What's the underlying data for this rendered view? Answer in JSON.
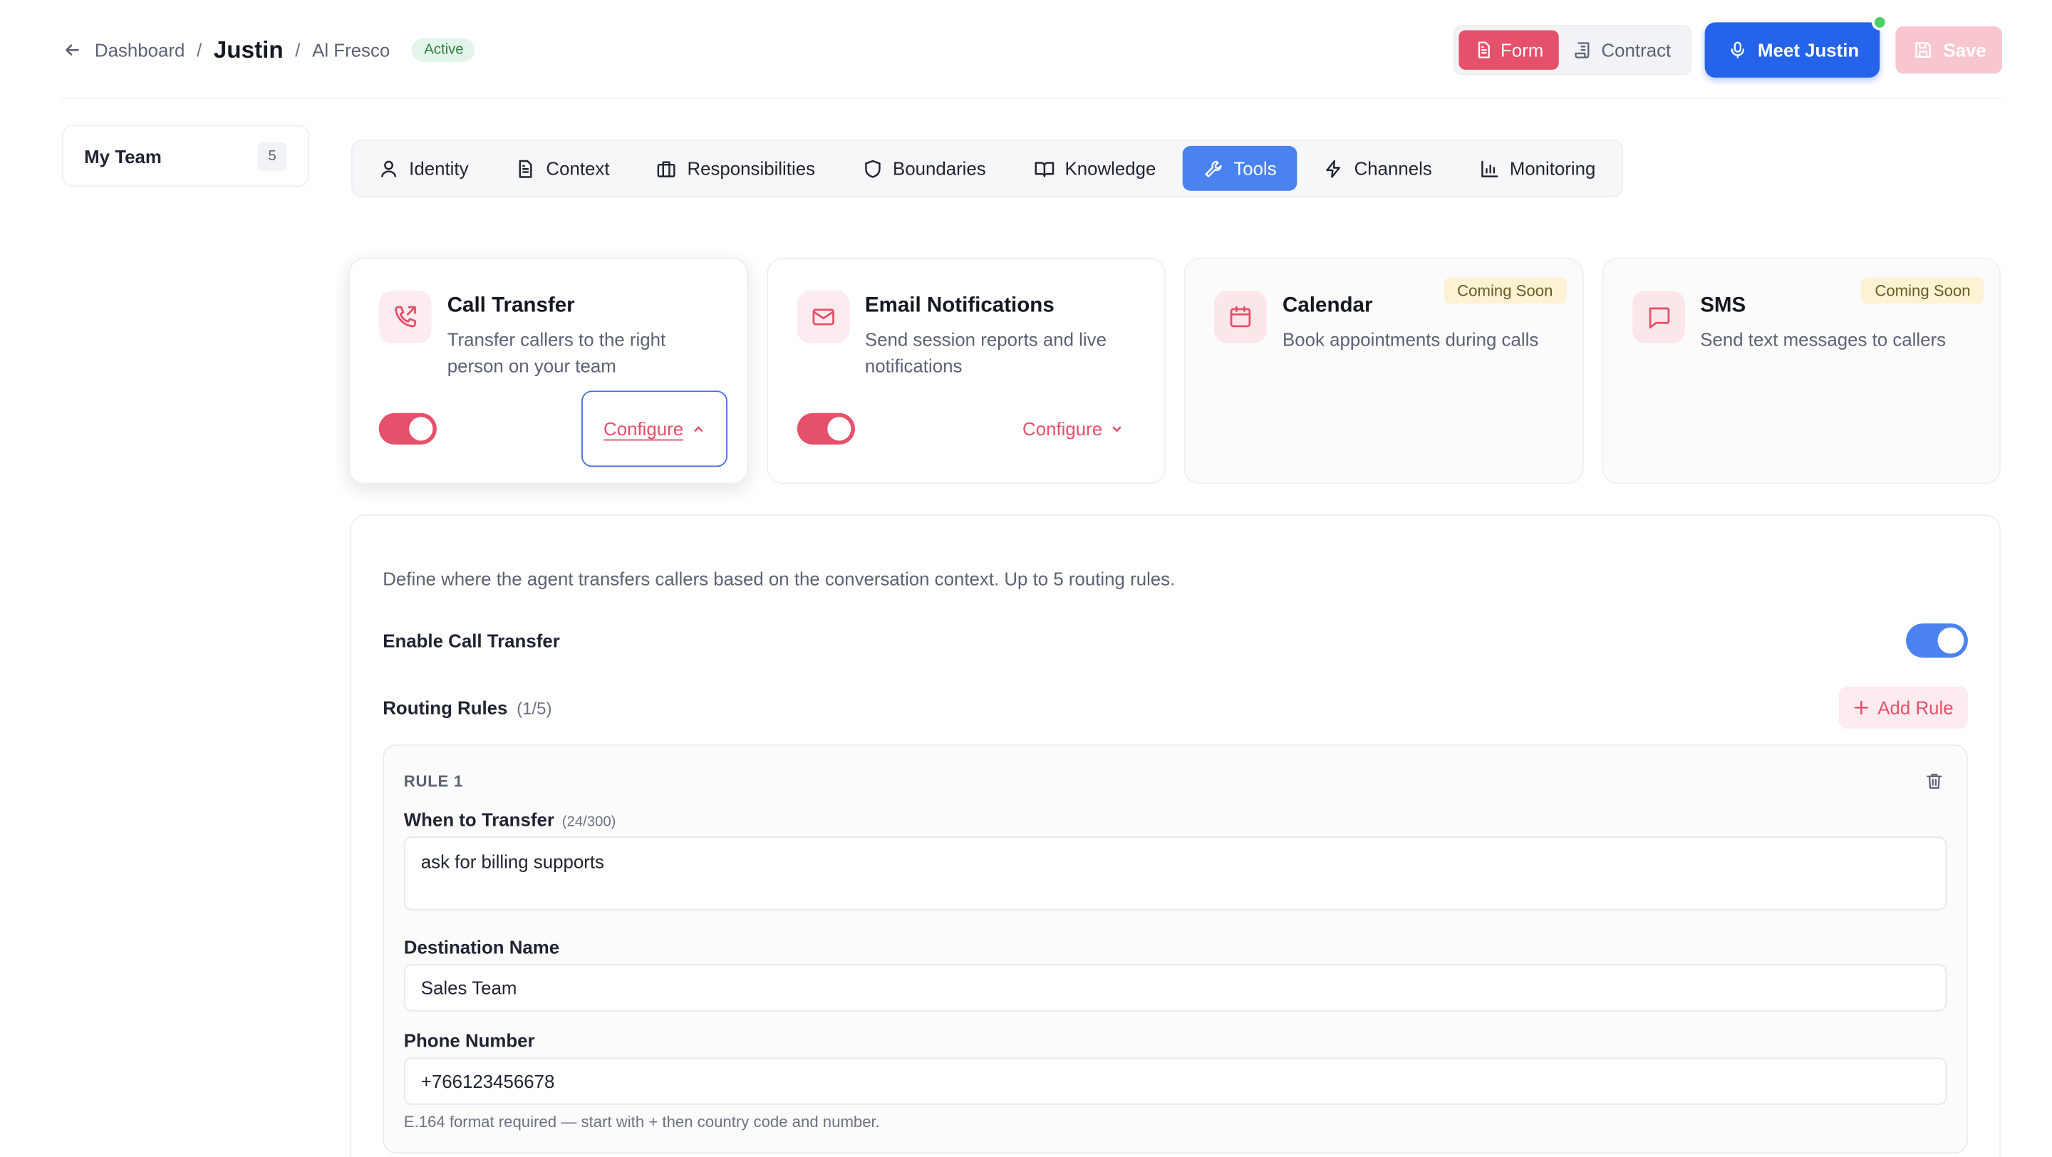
{
  "breadcrumb": {
    "dashboard": "Dashboard",
    "sep": "/",
    "agent": "Justin",
    "company": "Al Fresco",
    "status": "Active"
  },
  "header": {
    "form": "Form",
    "contract": "Contract",
    "meet": "Meet Justin",
    "save": "Save"
  },
  "sidebar": {
    "team_label": "My Team",
    "team_count": "5"
  },
  "tabs": [
    {
      "label": "Identity",
      "icon": "user-icon"
    },
    {
      "label": "Context",
      "icon": "document-icon"
    },
    {
      "label": "Responsibilities",
      "icon": "briefcase-icon"
    },
    {
      "label": "Boundaries",
      "icon": "shield-icon"
    },
    {
      "label": "Knowledge",
      "icon": "book-icon"
    },
    {
      "label": "Tools",
      "icon": "wrench-icon"
    },
    {
      "label": "Channels",
      "icon": "lightning-icon"
    },
    {
      "label": "Monitoring",
      "icon": "bar-chart-icon"
    }
  ],
  "active_tab": "Tools",
  "tools": [
    {
      "title": "Call Transfer",
      "desc": "Transfer callers to the right person on your team",
      "enabled": true,
      "configure": "Configure",
      "icon": "phone-forward-icon"
    },
    {
      "title": "Email Notifications",
      "desc": "Send session reports and live notifications",
      "enabled": true,
      "configure": "Configure",
      "icon": "mail-icon"
    },
    {
      "title": "Calendar",
      "desc": "Book appointments during calls",
      "badge": "Coming Soon",
      "icon": "calendar-icon"
    },
    {
      "title": "SMS",
      "desc": "Send text messages to callers",
      "badge": "Coming Soon",
      "icon": "chat-icon"
    }
  ],
  "panel": {
    "description": "Define where the agent transfers callers based on the conversation context. Up to 5 routing rules.",
    "enable_label": "Enable Call Transfer",
    "enable_on": true,
    "rules_label": "Routing Rules",
    "rules_count": "(1/5)",
    "add_rule": "Add Rule",
    "rule": {
      "tag": "RULE 1",
      "when_label": "When to Transfer",
      "when_count": "(24/300)",
      "when_value": "ask for billing supports",
      "dest_label": "Destination Name",
      "dest_value": "Sales Team",
      "phone_label": "Phone Number",
      "phone_value": "+766123456678",
      "phone_hint": "E.164 format required — start with + then country code and number."
    }
  },
  "colors": {
    "accent_pink": "#e5506a",
    "accent_blue": "#4a82f0",
    "meet_blue": "#2563eb",
    "success": "#2f7d46"
  }
}
